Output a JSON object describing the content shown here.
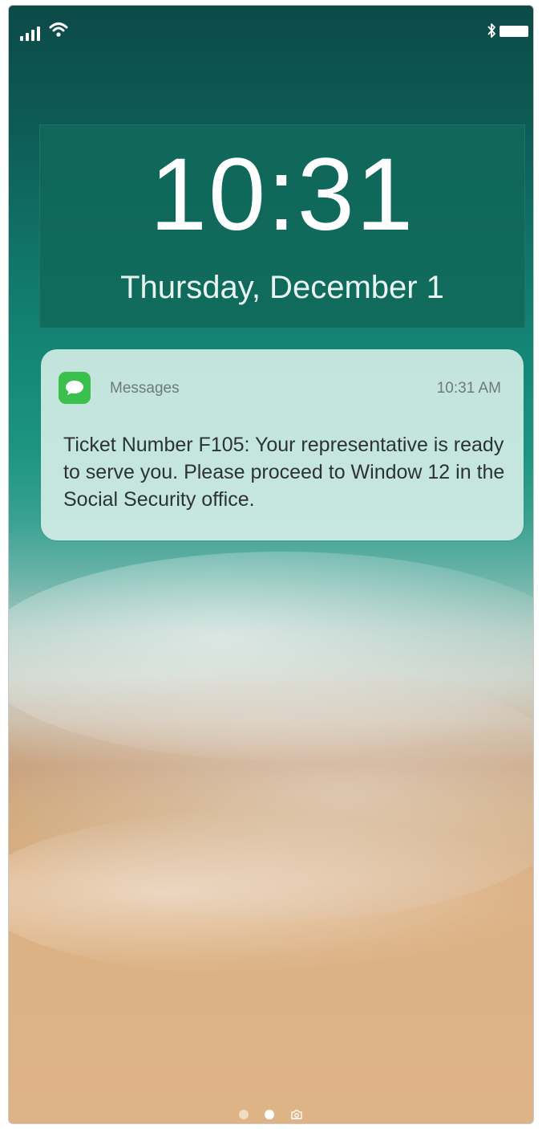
{
  "status_bar": {
    "signal_icon": "cellular-signal-icon",
    "wifi_icon": "wifi-icon",
    "bluetooth_icon": "bluetooth-icon",
    "battery_icon": "battery-icon",
    "signal_strength": 4,
    "battery_level": 1.0
  },
  "lock_screen": {
    "time": "10:31",
    "date": "Thursday, December 1"
  },
  "notification": {
    "app_icon": "messages-icon",
    "app_name": "Messages",
    "time": "10:31 AM",
    "body": "Ticket Number F105: Your representative is ready to serve you. Please proceed to Window 12 in the Social Security office."
  },
  "page_indicator": {
    "pages": [
      "page",
      "page-current",
      "camera"
    ],
    "current_index": 1,
    "camera_icon": "camera-icon"
  },
  "colors": {
    "notification_bg": "#d6eee8",
    "clock_panel_bg": "#10695a",
    "messages_green": "#3cc04d",
    "text_dark": "#2d3332",
    "text_muted": "#6f7a77"
  }
}
